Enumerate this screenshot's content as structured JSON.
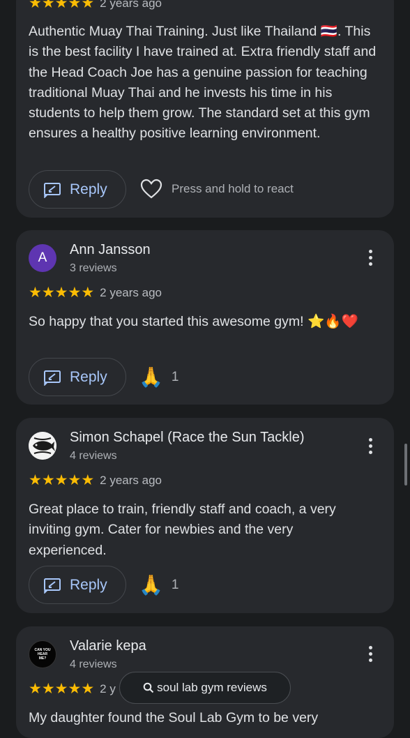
{
  "reviews": [
    {
      "date": "2 years ago",
      "body": "Authentic Muay Thai Training. Just like Thailand 🇹🇭. This is the best facility I have trained at. Extra friendly staff and the Head Coach Joe has a genuine passion for teaching traditional Muay Thai and he invests his time in his students to help them grow. The standard set at this gym ensures a healthy positive learning environment.",
      "reply_label": "Reply",
      "react_hint": "Press and hold to react",
      "rating": 5
    },
    {
      "name": "Ann Jansson",
      "avatar_letter": "A",
      "review_count": "3 reviews",
      "date": "2 years ago",
      "body": "So happy that you started this awesome gym! ⭐🔥❤️",
      "reply_label": "Reply",
      "reaction_emoji": "🙏",
      "reaction_count": "1",
      "rating": 5
    },
    {
      "name": "Simon Schapel (Race the Sun Tackle)",
      "review_count": "4 reviews",
      "date": "2 years ago",
      "body": "Great place to train, friendly staff and coach, a very inviting gym. Cater for newbies and the very experienced.",
      "reply_label": "Reply",
      "reaction_emoji": "🙏",
      "reaction_count": "1",
      "rating": 5
    },
    {
      "name": "Valarie kepa",
      "avatar_text": "CAN YOU HEAR ME?",
      "review_count": "4 reviews",
      "date": "2 y",
      "body": "My daughter found the Soul Lab Gym to be very",
      "rating": 5
    }
  ],
  "search_pill": {
    "label": "soul lab gym reviews",
    "icon": "search-icon"
  },
  "colors": {
    "star": "#fbbc04",
    "accent": "#a8c7fa",
    "card": "#27292d",
    "avatar_purple": "#5e35b1"
  }
}
